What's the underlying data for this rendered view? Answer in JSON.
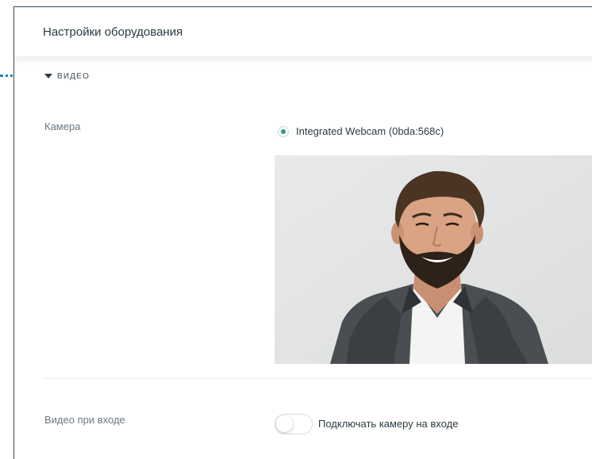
{
  "header": {
    "title": "Настройки оборудования"
  },
  "video_section": {
    "label": "ВИДЕО",
    "camera": {
      "label": "Камера",
      "option": "Integrated Webcam (0bda:568c)",
      "selected": true
    },
    "join_video": {
      "label": "Видео при входе",
      "toggle_text": "Подключать камеру на входе",
      "enabled": false
    }
  },
  "colors": {
    "accent": "#2e9d86",
    "dotted_marker": "#2a7bbf",
    "border": "#3a4a55"
  },
  "icons": {
    "section_caret": "caret-down-icon",
    "camera_radio": "radio-selected-icon"
  }
}
